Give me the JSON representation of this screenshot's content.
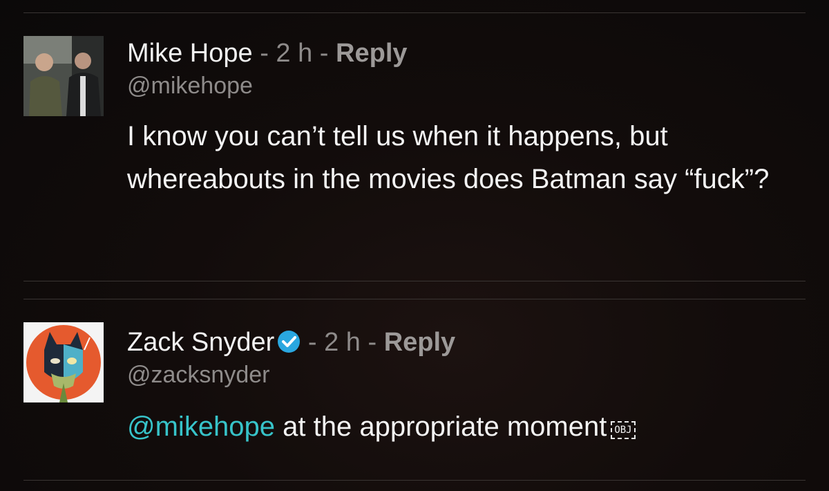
{
  "comments": [
    {
      "author": "Mike Hope",
      "sep1": " - ",
      "time": "2 h",
      "sep2": " - ",
      "reply_label": "Reply",
      "handle": "@mikehope",
      "text": "I know you can’t tell us when it happens, but whereabouts in the movies does Batman say “fuck”?",
      "verified": false
    },
    {
      "author": "Zack Snyder",
      "sep1": " - ",
      "time": "2 h",
      "sep2": " - ",
      "reply_label": "Reply",
      "handle": "@zacksnyder",
      "mention": "@mikehope",
      "text": " at the appropriate moment",
      "obj_glyph": "OBJ",
      "verified": true
    }
  ],
  "colors": {
    "accent": "#37c3c9",
    "verified_badge": "#2aa7e0",
    "meta_text": "#8e8b8a"
  }
}
